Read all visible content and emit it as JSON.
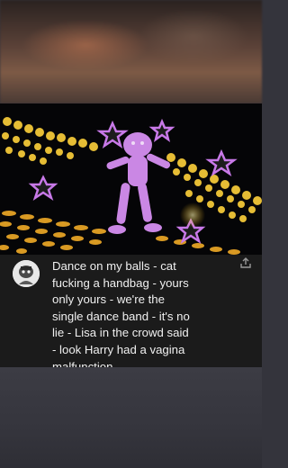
{
  "background": {
    "top_color": "#7d5a46",
    "bottom_color": "#34343c"
  },
  "video": {
    "description_icon": "dancing-character-icon",
    "accent_colors": [
      "#ffd84a",
      "#c86de0",
      "#1a1a1a"
    ]
  },
  "comment": {
    "avatar_icon": "avatar-icon",
    "share_icon": "share-icon",
    "text": "Dance on my balls - cat\nfucking a handbag - yours\nonly yours - we're the\nsingle dance band - it's no\nlie - Lisa in the crowd said\n- look Harry had a vagina\nmalfunction"
  }
}
